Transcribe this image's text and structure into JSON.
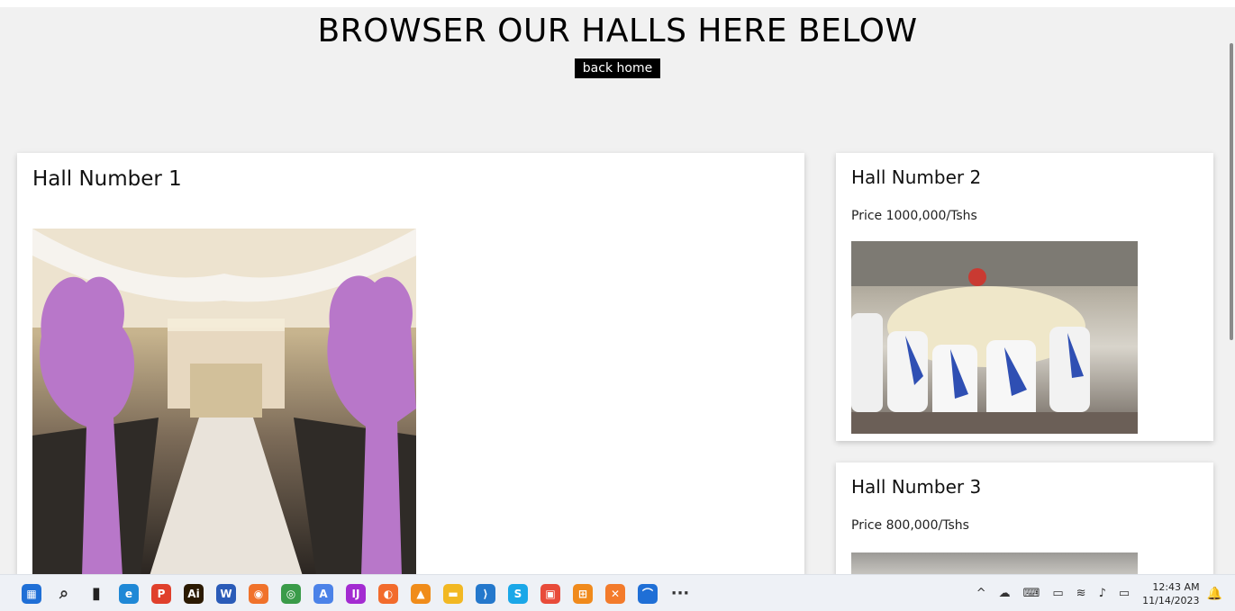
{
  "header": {
    "title": "BROWSER OUR HALLS HERE BELOW",
    "back_label": "back home"
  },
  "halls": [
    {
      "name": "Hall Number 1"
    },
    {
      "name": "Hall Number 2",
      "price": "Price 1000,000/Tshs"
    },
    {
      "name": "Hall Number 3",
      "price": "Price 800,000/Tshs"
    }
  ],
  "taskbar": {
    "apps": [
      {
        "name": "start-icon",
        "glyph": "▦",
        "color": "#1f6fd6"
      },
      {
        "name": "search-icon",
        "glyph": "⌕",
        "color": "#333333"
      },
      {
        "name": "task-view-icon",
        "glyph": "▮",
        "color": "#222222"
      },
      {
        "name": "edge-icon",
        "glyph": "e",
        "color": "#1f88d6"
      },
      {
        "name": "pdf-app-icon",
        "glyph": "P",
        "color": "#e0402c"
      },
      {
        "name": "illustrator-icon",
        "glyph": "Ai",
        "color": "#2b1a02"
      },
      {
        "name": "word-icon",
        "glyph": "W",
        "color": "#2a5bb8"
      },
      {
        "name": "firefox-icon",
        "glyph": "◉",
        "color": "#f0722b"
      },
      {
        "name": "chrome-icon",
        "glyph": "◎",
        "color": "#3a9b49"
      },
      {
        "name": "app-store-icon",
        "glyph": "A",
        "color": "#4b82e8"
      },
      {
        "name": "intellij-icon",
        "glyph": "IJ",
        "color": "#a32bd1"
      },
      {
        "name": "postman-icon",
        "glyph": "◐",
        "color": "#f26b2c"
      },
      {
        "name": "vlc-icon",
        "glyph": "▲",
        "color": "#f08c1a"
      },
      {
        "name": "file-explorer-icon",
        "glyph": "▬",
        "color": "#f2b823"
      },
      {
        "name": "vscode-icon",
        "glyph": "⟩",
        "color": "#2478cc"
      },
      {
        "name": "skype-icon",
        "glyph": "S",
        "color": "#1aa7e8"
      },
      {
        "name": "calendar-app-icon",
        "glyph": "▣",
        "color": "#e84b3a"
      },
      {
        "name": "network-app-icon",
        "glyph": "⊞",
        "color": "#f08a1c"
      },
      {
        "name": "xampp-icon",
        "glyph": "✕",
        "color": "#f37b2b"
      },
      {
        "name": "widget-icon",
        "glyph": "⌒",
        "color": "#1f6fd6"
      },
      {
        "name": "more-apps-icon",
        "glyph": "···",
        "color": "#333333"
      }
    ],
    "tray": {
      "chevron": "^",
      "time": "12:43 AM",
      "date": "11/14/2023"
    }
  }
}
